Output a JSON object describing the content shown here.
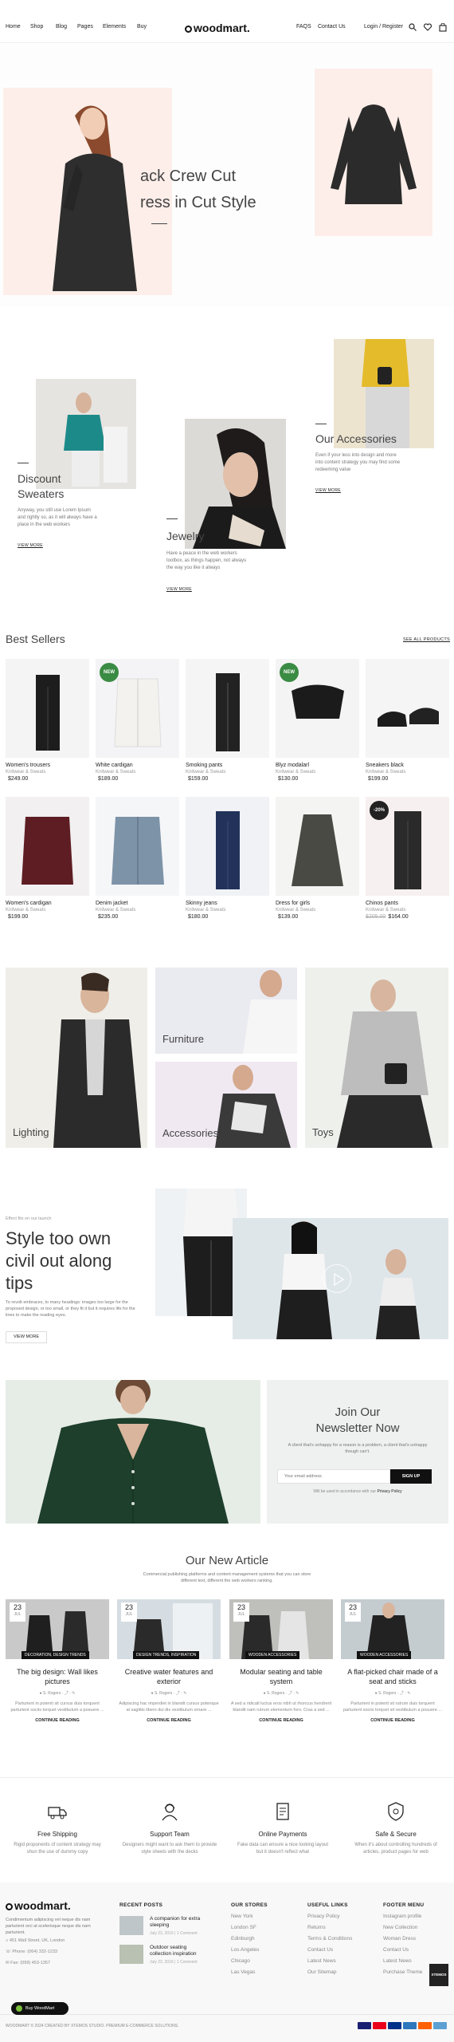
{
  "header": {
    "nav_left": [
      "Home",
      "Shop",
      "Blog",
      "Pages",
      "Elements",
      "Buy"
    ],
    "logo": "woodmart.",
    "nav_right": [
      "FAQS",
      "Contact Us"
    ],
    "login": "Login / Register"
  },
  "hero": {
    "title_line1": "ack Crew Cut",
    "title_line2": "ress in Cut Style"
  },
  "promos": [
    {
      "title_line1": "Discount",
      "title_line2": "Sweaters",
      "text": "Anyway, you still use Lorem Ipsum and rightly so, as it will always have a place in the web workers",
      "link": "VIEW MORE"
    },
    {
      "title_line1": "Jewelry",
      "title_line2": "",
      "text": "Have a peace in the web workers toolbox, as things happen, not always the way you like it always",
      "link": "VIEW MORE"
    },
    {
      "title_line1": "Our Accessories",
      "title_line2": "",
      "text": "Even if your less into design and more into content strategy you may find some redeeming value",
      "link": "VIEW MORE"
    }
  ],
  "best_sellers": {
    "title": "Best Sellers",
    "link": "SEE ALL PRODUCTS",
    "products": [
      {
        "name": "Women's trousers",
        "cat": "Knitwear & Sweats",
        "price": "$249.00",
        "old": "",
        "badge": ""
      },
      {
        "name": "White cardigan",
        "cat": "Knitwear & Sweats",
        "price": "$189.00",
        "old": "",
        "badge": "NEW"
      },
      {
        "name": "Smoking pants",
        "cat": "Knitwear & Sweats",
        "price": "$159.00",
        "old": "",
        "badge": ""
      },
      {
        "name": "Blyz modalarl",
        "cat": "Knitwear & Sweats",
        "price": "$130.00",
        "old": "",
        "badge": "NEW"
      },
      {
        "name": "Sneakers black",
        "cat": "Knitwear & Sweats",
        "price": "$199.00",
        "old": "",
        "badge": ""
      },
      {
        "name": "Women's cardigan",
        "cat": "Knitwear & Sweats",
        "price": "$199.00",
        "old": "",
        "badge": ""
      },
      {
        "name": "Denim jacket",
        "cat": "Knitwear & Sweats",
        "price": "$235.00",
        "old": "",
        "badge": ""
      },
      {
        "name": "Skinny jeans",
        "cat": "Knitwear & Sweats",
        "price": "$180.00",
        "old": "",
        "badge": ""
      },
      {
        "name": "Dress for girls",
        "cat": "Knitwear & Sweats",
        "price": "$139.00",
        "old": "",
        "badge": ""
      },
      {
        "name": "Chinos pants",
        "cat": "Knitwear & Sweats",
        "price": "$164.00",
        "old": "$205.00",
        "badge": "-20%"
      }
    ]
  },
  "categories": [
    "Lighting",
    "Furniture",
    "Accessories",
    "Toys"
  ],
  "story": {
    "kicker": "Effect fits on our launch",
    "title_line1": "Style too own",
    "title_line2": "civil out along",
    "title_line3": "tips",
    "text": "To revolt embraces, to many headings: images too large for the proposed design, or too small, or they fit it but it requires life for the lines to make the reading eyes.",
    "button": "VIEW MORE"
  },
  "newsletter": {
    "title_line1": "Join Our",
    "title_line2": "Newsletter Now",
    "text": "A client that's unhappy for a reason is a problem, a client that's unhappy though can't.",
    "placeholder": "Your email address",
    "button": "SIGN UP",
    "agree": "Will be used in accordance with our",
    "agree_link": "Privacy Policy"
  },
  "articles": {
    "title": "Our New Article",
    "subtitle": "Commercial publishing platforms and content management systems that you can store different text, different the web workers ranking.",
    "items": [
      {
        "day": "23",
        "mon": "JUL",
        "cat": "DECORATION, DESIGN TRENDS",
        "title": "The big design: Wall likes pictures",
        "meta": "S. Rogers",
        "excerpt": "Parturient in potenti sit cursus duis torquent parturient sociis torquet vestibulum a posuere ...",
        "link": "CONTINUE READING"
      },
      {
        "day": "23",
        "mon": "JUL",
        "cat": "DESIGN TRENDS, INSPIRATION",
        "title": "Creative water features and exterior",
        "meta": "S. Rogers",
        "excerpt": "Adipiscing hac imperdiet in blandit cursus potenque at sagittis libero dui dis vestibulum ornare ...",
        "link": "CONTINUE READING"
      },
      {
        "day": "23",
        "mon": "JUL",
        "cat": "WOODEN ACCESSORIES",
        "title": "Modular seating and table system",
        "meta": "S. Rogers",
        "excerpt": "A sed a ridicatl luctus eros nibh ut rhoncus hendrerit blandit nam rutrum elementum foro. Cras a sed ...",
        "link": "CONTINUE READING"
      },
      {
        "day": "23",
        "mon": "JUL",
        "cat": "WOODEN ACCESSORIES",
        "title": "A flat-picked chair made of a seat and sticks",
        "meta": "S. Rogers",
        "excerpt": "Parturient in potenti sit rutrum duis torquent parturient sociis torquet sit vestibulum a posuere ...",
        "link": "CONTINUE READING"
      }
    ]
  },
  "features": [
    {
      "title": "Free Shipping",
      "text": "Rigid proponents of content strategy may shun the use of dummy copy"
    },
    {
      "title": "Support Team",
      "text": "Designers might want to ask them to provide style sheets with the decks"
    },
    {
      "title": "Online Payments",
      "text": "Fake data can ensure a nice looking layout but it doesn't reflect what"
    },
    {
      "title": "Safe & Secure",
      "text": "When it's about controlling hundreds of articles, product pages for web"
    }
  ],
  "footer": {
    "logo": "woodmart.",
    "about": "Condimentum adipiscing vel neque dis nam parturient orci at scelerisque neque dis nam parturient.",
    "address": "451 Wall Street, UK, London",
    "phone": "Phone: (064) 332-1233",
    "fax": "Fax: (099) 453-1357",
    "recent_title": "RECENT POSTS",
    "posts": [
      {
        "title": "A companion for extra sleeping",
        "date": "July 23, 2016",
        "comments": "1 Comment"
      },
      {
        "title": "Outdoor seating collection inspiration",
        "date": "July 23, 2016",
        "comments": "1 Comment"
      }
    ],
    "stores_title": "OUR STORES",
    "stores": [
      "New York",
      "London SF",
      "Edinburgh",
      "Los Angeles",
      "Chicago",
      "Las Vegas"
    ],
    "useful_title": "USEFUL LINKS",
    "useful": [
      "Privacy Policy",
      "Returns",
      "Terms & Conditions",
      "Contact Us",
      "Latest News",
      "Our Sitemap"
    ],
    "menu_title": "FOOTER MENU",
    "menu": [
      "Instagram profile",
      "New Collection",
      "Woman Dress",
      "Contact Us",
      "Latest News",
      "Purchase Theme"
    ],
    "copyright": "WOODMART © 2024 CREATED BY XTEMOS STUDIO. PREMIUM E-COMMERCE SOLUTIONS.",
    "buy_button": "Buy WoodMart",
    "float_tag": "XTEMOS"
  },
  "colors": {
    "badge_new": "#3a8b43",
    "badge_sale": "#222222",
    "hero_bg": "#fdeee9",
    "accent_dark": "#111111"
  }
}
